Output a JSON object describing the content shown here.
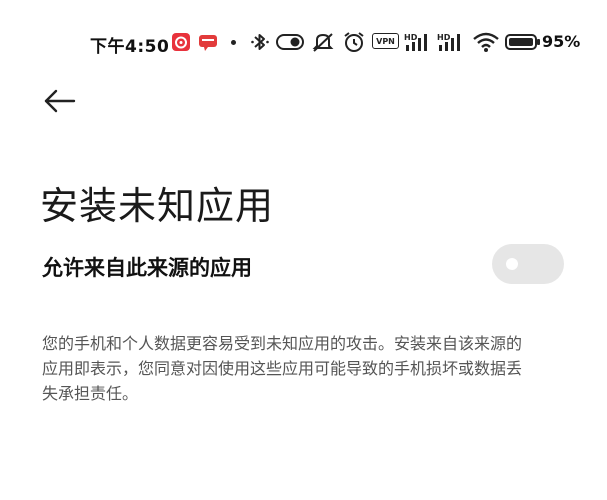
{
  "status_bar": {
    "time": "下午4:50",
    "battery_percent": "95%",
    "vpn_label": "VPN",
    "signal_label_1": "HD",
    "signal_label_2": "HD",
    "icons": [
      "netease-music-icon",
      "chat-app-icon",
      "dot-icon",
      "bluetooth-icon",
      "nfc-toggle-icon",
      "mute-icon",
      "alarm-icon",
      "vpn-icon",
      "signal-icon",
      "signal-icon",
      "wifi-icon",
      "battery-icon"
    ]
  },
  "page": {
    "title": "安装未知应用"
  },
  "setting": {
    "label": "允许来自此来源的应用",
    "enabled": false
  },
  "warning": {
    "text": "您的手机和个人数据更容易受到未知应用的攻击。安装来自该来源的应用即表示，您同意对因使用这些应用可能导致的手机损坏或数据丢失承担责任。"
  },
  "colors": {
    "background": "#ffffff",
    "title_text": "#1a1a1a",
    "warning_text": "#555555",
    "toggle_track_off": "#e6e6e6",
    "toggle_knob": "#ffffff",
    "netease_red": "#e8323c",
    "chat_red": "#e23b3b"
  }
}
